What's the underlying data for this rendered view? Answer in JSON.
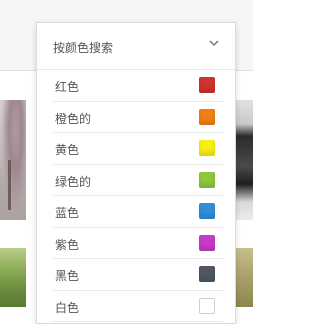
{
  "color_filter": {
    "title": "按颜色搜索",
    "items": [
      {
        "label": "红色",
        "color": "#d0322c"
      },
      {
        "label": "橙色的",
        "color": "#f07f16"
      },
      {
        "label": "黄色",
        "color": "#f9ef16"
      },
      {
        "label": "绿色的",
        "color": "#8fc73a"
      },
      {
        "label": "蓝色",
        "color": "#2f8fdc"
      },
      {
        "label": "紫色",
        "color": "#c83bc9"
      },
      {
        "label": "黑色",
        "color": "#4f5861"
      },
      {
        "label": "白色",
        "color": "#ffffff"
      }
    ]
  }
}
